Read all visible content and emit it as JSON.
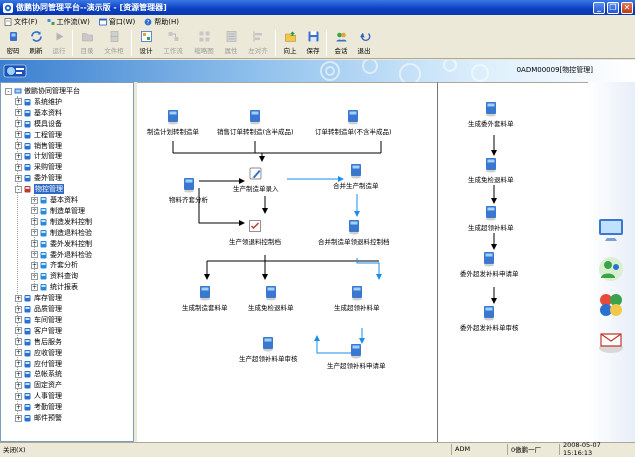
{
  "window": {
    "title": "傲鹏协同管理平台--演示版 - [资源管理器]",
    "min": "_",
    "restore": "❐",
    "close": "✕"
  },
  "menu": [
    {
      "label": "文件(F)",
      "icon": "file-icon"
    },
    {
      "label": "工作流(W)",
      "icon": "workflow-icon"
    },
    {
      "label": "窗口(W)",
      "icon": "window-icon"
    },
    {
      "label": "帮助(H)",
      "icon": "help-icon"
    }
  ],
  "toolbar": [
    {
      "label": "密码",
      "icon": "password-icon",
      "enabled": true
    },
    {
      "label": "刷新",
      "icon": "refresh-icon",
      "enabled": true
    },
    {
      "label": "运行",
      "icon": "run-icon",
      "enabled": false
    },
    {
      "label": "目录",
      "icon": "folder-icon",
      "enabled": false
    },
    {
      "label": "文件柜",
      "icon": "cabinet-icon",
      "enabled": false
    },
    {
      "label": "设计",
      "icon": "design-icon",
      "enabled": true
    },
    {
      "label": "工作流",
      "icon": "workflow-icon",
      "enabled": false
    },
    {
      "label": "缩略图",
      "icon": "thumbnail-icon",
      "enabled": false
    },
    {
      "label": "属性",
      "icon": "properties-icon",
      "enabled": false
    },
    {
      "label": "左对齐",
      "icon": "align-left-icon",
      "enabled": false
    },
    {
      "label": "向上",
      "icon": "up-icon",
      "enabled": true
    },
    {
      "label": "保存",
      "icon": "save-icon",
      "enabled": true
    },
    {
      "label": "会话",
      "icon": "chat-icon",
      "enabled": true
    },
    {
      "label": "退出",
      "icon": "exit-icon",
      "enabled": true
    }
  ],
  "banner": {
    "code": "0ADM00009[物控管理]"
  },
  "tree": {
    "root": "傲鹏协同管理平台",
    "items": [
      {
        "label": "系统维护",
        "expanded": false
      },
      {
        "label": "基本资料",
        "expanded": false
      },
      {
        "label": "模具设备",
        "expanded": false
      },
      {
        "label": "工程管理",
        "expanded": false
      },
      {
        "label": "销售管理",
        "expanded": false
      },
      {
        "label": "计划管理",
        "expanded": false
      },
      {
        "label": "采购管理",
        "expanded": false
      },
      {
        "label": "委外管理",
        "expanded": false
      },
      {
        "label": "物控管理",
        "expanded": true,
        "selected": true
      },
      {
        "label": "基本资料",
        "child": true
      },
      {
        "label": "制造单管理",
        "child": true
      },
      {
        "label": "制造发料控制",
        "child": true
      },
      {
        "label": "制造退料检验",
        "child": true
      },
      {
        "label": "委外发料控制",
        "child": true
      },
      {
        "label": "委外退料检验",
        "child": true
      },
      {
        "label": "齐套分析",
        "child": true
      },
      {
        "label": "资料查询",
        "child": true
      },
      {
        "label": "统计报表",
        "child": true
      },
      {
        "label": "库存管理",
        "expanded": false
      },
      {
        "label": "品质管理",
        "expanded": false
      },
      {
        "label": "车间管理",
        "expanded": false
      },
      {
        "label": "客户管理",
        "expanded": false
      },
      {
        "label": "售后服务",
        "expanded": false
      },
      {
        "label": "应收管理",
        "expanded": false
      },
      {
        "label": "应付管理",
        "expanded": false
      },
      {
        "label": "总帐系统",
        "expanded": false
      },
      {
        "label": "固定资产",
        "expanded": false
      },
      {
        "label": "人事管理",
        "expanded": false
      },
      {
        "label": "考勤管理",
        "expanded": false
      },
      {
        "label": "邮件预警",
        "expanded": false
      }
    ]
  },
  "flow_left": {
    "n1": "制造计划转制造单",
    "n2": "销售订单转制造(含半成品)",
    "n3": "订单转制造单(不含半成品)",
    "n4": "生产制造单录入",
    "n5": "合并生产制造单",
    "n6": "物料齐套分析",
    "n7": "生产领退料控制档",
    "n8": "合并制造单领退料控制档",
    "n9": "生成制造套料单",
    "n10": "生成免检退料单",
    "n11": "生成超领补料单",
    "n12": "生产超领补料单审核",
    "n13": "生产超领补料申请单"
  },
  "flow_right": {
    "r1": "生成委外套料单",
    "r2": "生成免检退料单",
    "r3": "生成超领补料单",
    "r4": "委外超发补料申请单",
    "r5": "委外超发补料单审核"
  },
  "status": {
    "close": "关闭(X)",
    "user": "ADM",
    "company": "0傲鹏一厂",
    "datetime": "2008-05-07 15:16:13"
  }
}
